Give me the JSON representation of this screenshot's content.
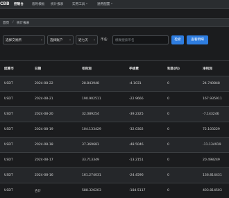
{
  "header": {
    "brand": "CBB",
    "nav": [
      {
        "label": "控制台",
        "active": true
      },
      {
        "label": "套利模板",
        "active": false
      },
      {
        "label": "统计报表",
        "active": false
      },
      {
        "label": "实用工具",
        "active": false,
        "dropdown": true
      },
      {
        "label": "通用配置",
        "active": false,
        "dropdown": true
      }
    ]
  },
  "breadcrumb": {
    "home": "首页",
    "separator": "/",
    "current": "统计报表"
  },
  "filters": {
    "exchange": "选择交易所",
    "account": "选择账户",
    "period": "近七天",
    "coin_label": "币名:",
    "search_placeholder": "模糊搜索币名",
    "search_button": "检索",
    "detail_button": "查看明细"
  },
  "table": {
    "columns": [
      "结算币",
      "日期",
      "毛利润",
      "手续费",
      "利息(约)",
      "净利润"
    ],
    "rows": [
      [
        "USDT",
        "2024-08-22",
        "28.843948",
        "-4.1031",
        "0",
        "24.740848"
      ],
      [
        "USDT",
        "2024-08-21",
        "190.902511",
        "-22.9666",
        "0",
        "167.935911"
      ],
      [
        "USDT",
        "2024-08-20",
        "32.089254",
        "-39.2325",
        "0",
        "-7.143246"
      ],
      [
        "USDT",
        "2024-08-19",
        "104.133429",
        "-32.0302",
        "0",
        "72.103229"
      ],
      [
        "USDT",
        "2024-08-18",
        "37.369681",
        "-48.5046",
        "0",
        "-11.134919"
      ],
      [
        "USDT",
        "2024-08-17",
        "33.713349",
        "-13.2151",
        "0",
        "20.498249"
      ],
      [
        "USDT",
        "2024-08-16",
        "161.274031",
        "-24.4596",
        "0",
        "136.814431"
      ],
      [
        "USDT",
        "合计",
        "588.326203",
        "-184.5117",
        "0",
        "403.814503"
      ]
    ]
  }
}
